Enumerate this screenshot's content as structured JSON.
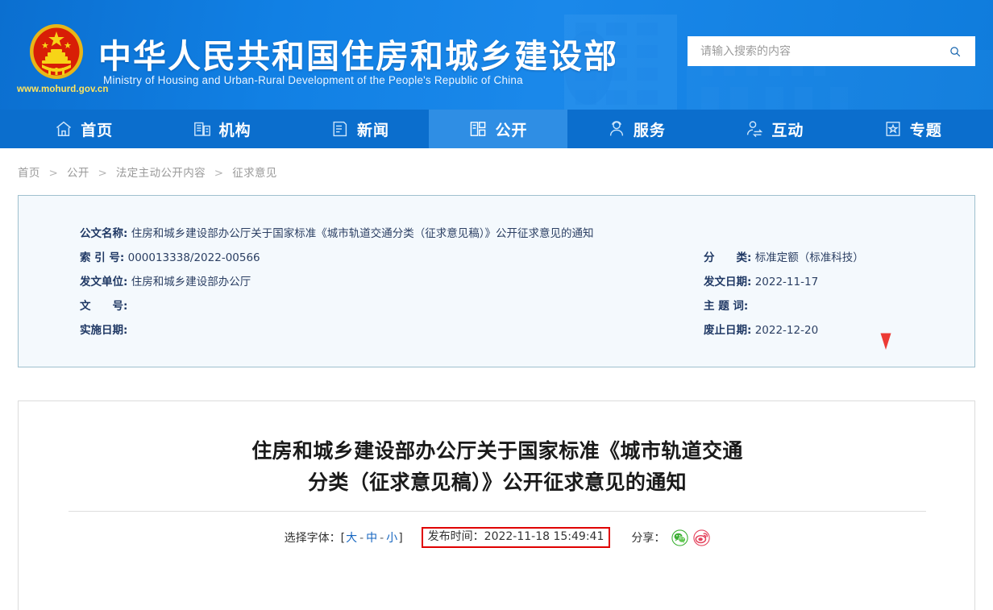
{
  "header": {
    "title_cn": "中华人民共和国住房和城乡建设部",
    "title_en": "Ministry of Housing and Urban-Rural Development of the People's Republic of China",
    "url": "www.mohurd.gov.cn",
    "emblem_icon": "national-emblem-icon",
    "accent_blue": "#0f7fe0"
  },
  "search": {
    "placeholder": "请输入搜索的内容",
    "value": "",
    "icon": "search-icon"
  },
  "nav": {
    "items": [
      {
        "label": "首页",
        "icon": "home-icon",
        "active": false
      },
      {
        "label": "机构",
        "icon": "building-icon",
        "active": false
      },
      {
        "label": "新闻",
        "icon": "news-document-icon",
        "active": false
      },
      {
        "label": "公开",
        "icon": "open-disclosure-icon",
        "active": true
      },
      {
        "label": "服务",
        "icon": "service-person-icon",
        "active": false
      },
      {
        "label": "互动",
        "icon": "interaction-exchange-icon",
        "active": false
      },
      {
        "label": "专题",
        "icon": "star-topic-icon",
        "active": false
      }
    ],
    "active_bg": "#2f8ee4",
    "bar_bg": "#0b6ecd"
  },
  "breadcrumb": {
    "items": [
      "首页",
      "公开",
      "法定主动公开内容",
      "征求意见"
    ],
    "separator": ">"
  },
  "info_card": {
    "left": [
      {
        "label": "公文名称:",
        "value": "住房和城乡建设部办公厅关于国家标准《城市轨道交通分类（征求意见稿）》公开征求意见的通知"
      },
      {
        "label": "索 引 号:",
        "value": "000013338/2022-00566"
      },
      {
        "label": "发文单位:",
        "value": "住房和城乡建设部办公厅"
      },
      {
        "label": "文　　号:",
        "value": ""
      },
      {
        "label": "实施日期:",
        "value": ""
      }
    ],
    "right": [
      {
        "label": "分　　类:",
        "value": "标准定额（标准科技）"
      },
      {
        "label": "发文日期:",
        "value": "2022-11-17"
      },
      {
        "label": "主 题 词:",
        "value": ""
      },
      {
        "label": "废止日期:",
        "value": "2022-12-20"
      }
    ]
  },
  "article": {
    "title_line1": "住房和城乡建设部办公厅关于国家标准《城市轨道交通",
    "title_line2": "分类（征求意见稿）》公开征求意见的通知",
    "font_select_label": "选择字体：",
    "font_bracket_open": "[",
    "font_bracket_close": "]",
    "font_sizes": [
      "大",
      "中",
      "小"
    ],
    "font_size_dash": "-",
    "publish_label": "发布时间：",
    "publish_time": "2022-11-18 15:49:41",
    "publish_highlight_color": "#e00000",
    "share_label": "分享：",
    "share_icons": [
      "wechat-share-icon",
      "weibo-share-icon"
    ]
  },
  "cursor": {
    "icon": "red-cursor-arrow-icon",
    "color": "#e8372f"
  }
}
